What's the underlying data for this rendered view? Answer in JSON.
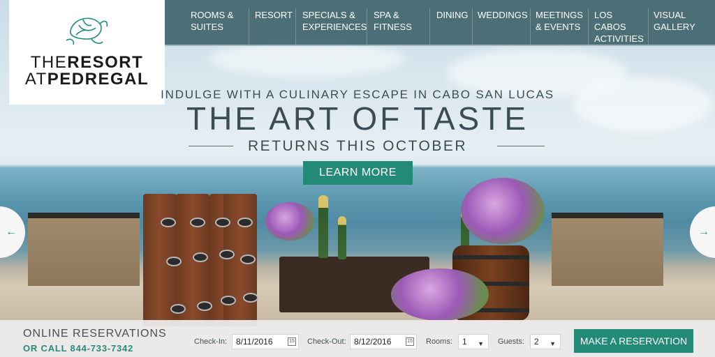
{
  "brand": {
    "logo_line1_light": "THE",
    "logo_line1_bold": "RESORT",
    "logo_line2_light": "AT",
    "logo_line2_bold": "PEDREGAL",
    "logo_icon": "turtle-icon"
  },
  "nav": {
    "items": [
      {
        "label": "ROOMS &\nSUITES"
      },
      {
        "label": "RESORT"
      },
      {
        "label": "SPECIALS &\nEXPERIENCES"
      },
      {
        "label": "SPA &\nFITNESS"
      },
      {
        "label": "DINING"
      },
      {
        "label": "WEDDINGS"
      },
      {
        "label": "MEETINGS\n& EVENTS"
      },
      {
        "label": "LOS\nCABOS\nACTIVITIES"
      },
      {
        "label": "VISUAL\nGALLERY"
      }
    ]
  },
  "hero": {
    "kicker": "INDULGE WITH A CULINARY ESCAPE IN CABO SAN LUCAS",
    "headline": "THE ART OF TASTE",
    "subline": "RETURNS THIS OCTOBER",
    "cta": "LEARN MORE",
    "prev_icon": "arrow-left-icon",
    "next_icon": "arrow-right-icon",
    "prev_glyph": "←",
    "next_glyph": "→"
  },
  "booking": {
    "title": "ONLINE RESERVATIONS",
    "phone": "OR CALL 844-733-7342",
    "checkin_label": "Check-In:",
    "checkin_value": "8/11/2016",
    "checkout_label": "Check-Out:",
    "checkout_value": "8/12/2016",
    "rooms_label": "Rooms:",
    "rooms_value": "1",
    "guests_label": "Guests:",
    "guests_value": "2",
    "submit": "MAKE A RESERVATION",
    "calendar_icon": "calendar-icon",
    "calendar_glyph": "15",
    "caret_glyph": "▼"
  },
  "colors": {
    "accent": "#238a78",
    "nav_bg": "#40646c",
    "text_dark": "#3a4d55"
  }
}
